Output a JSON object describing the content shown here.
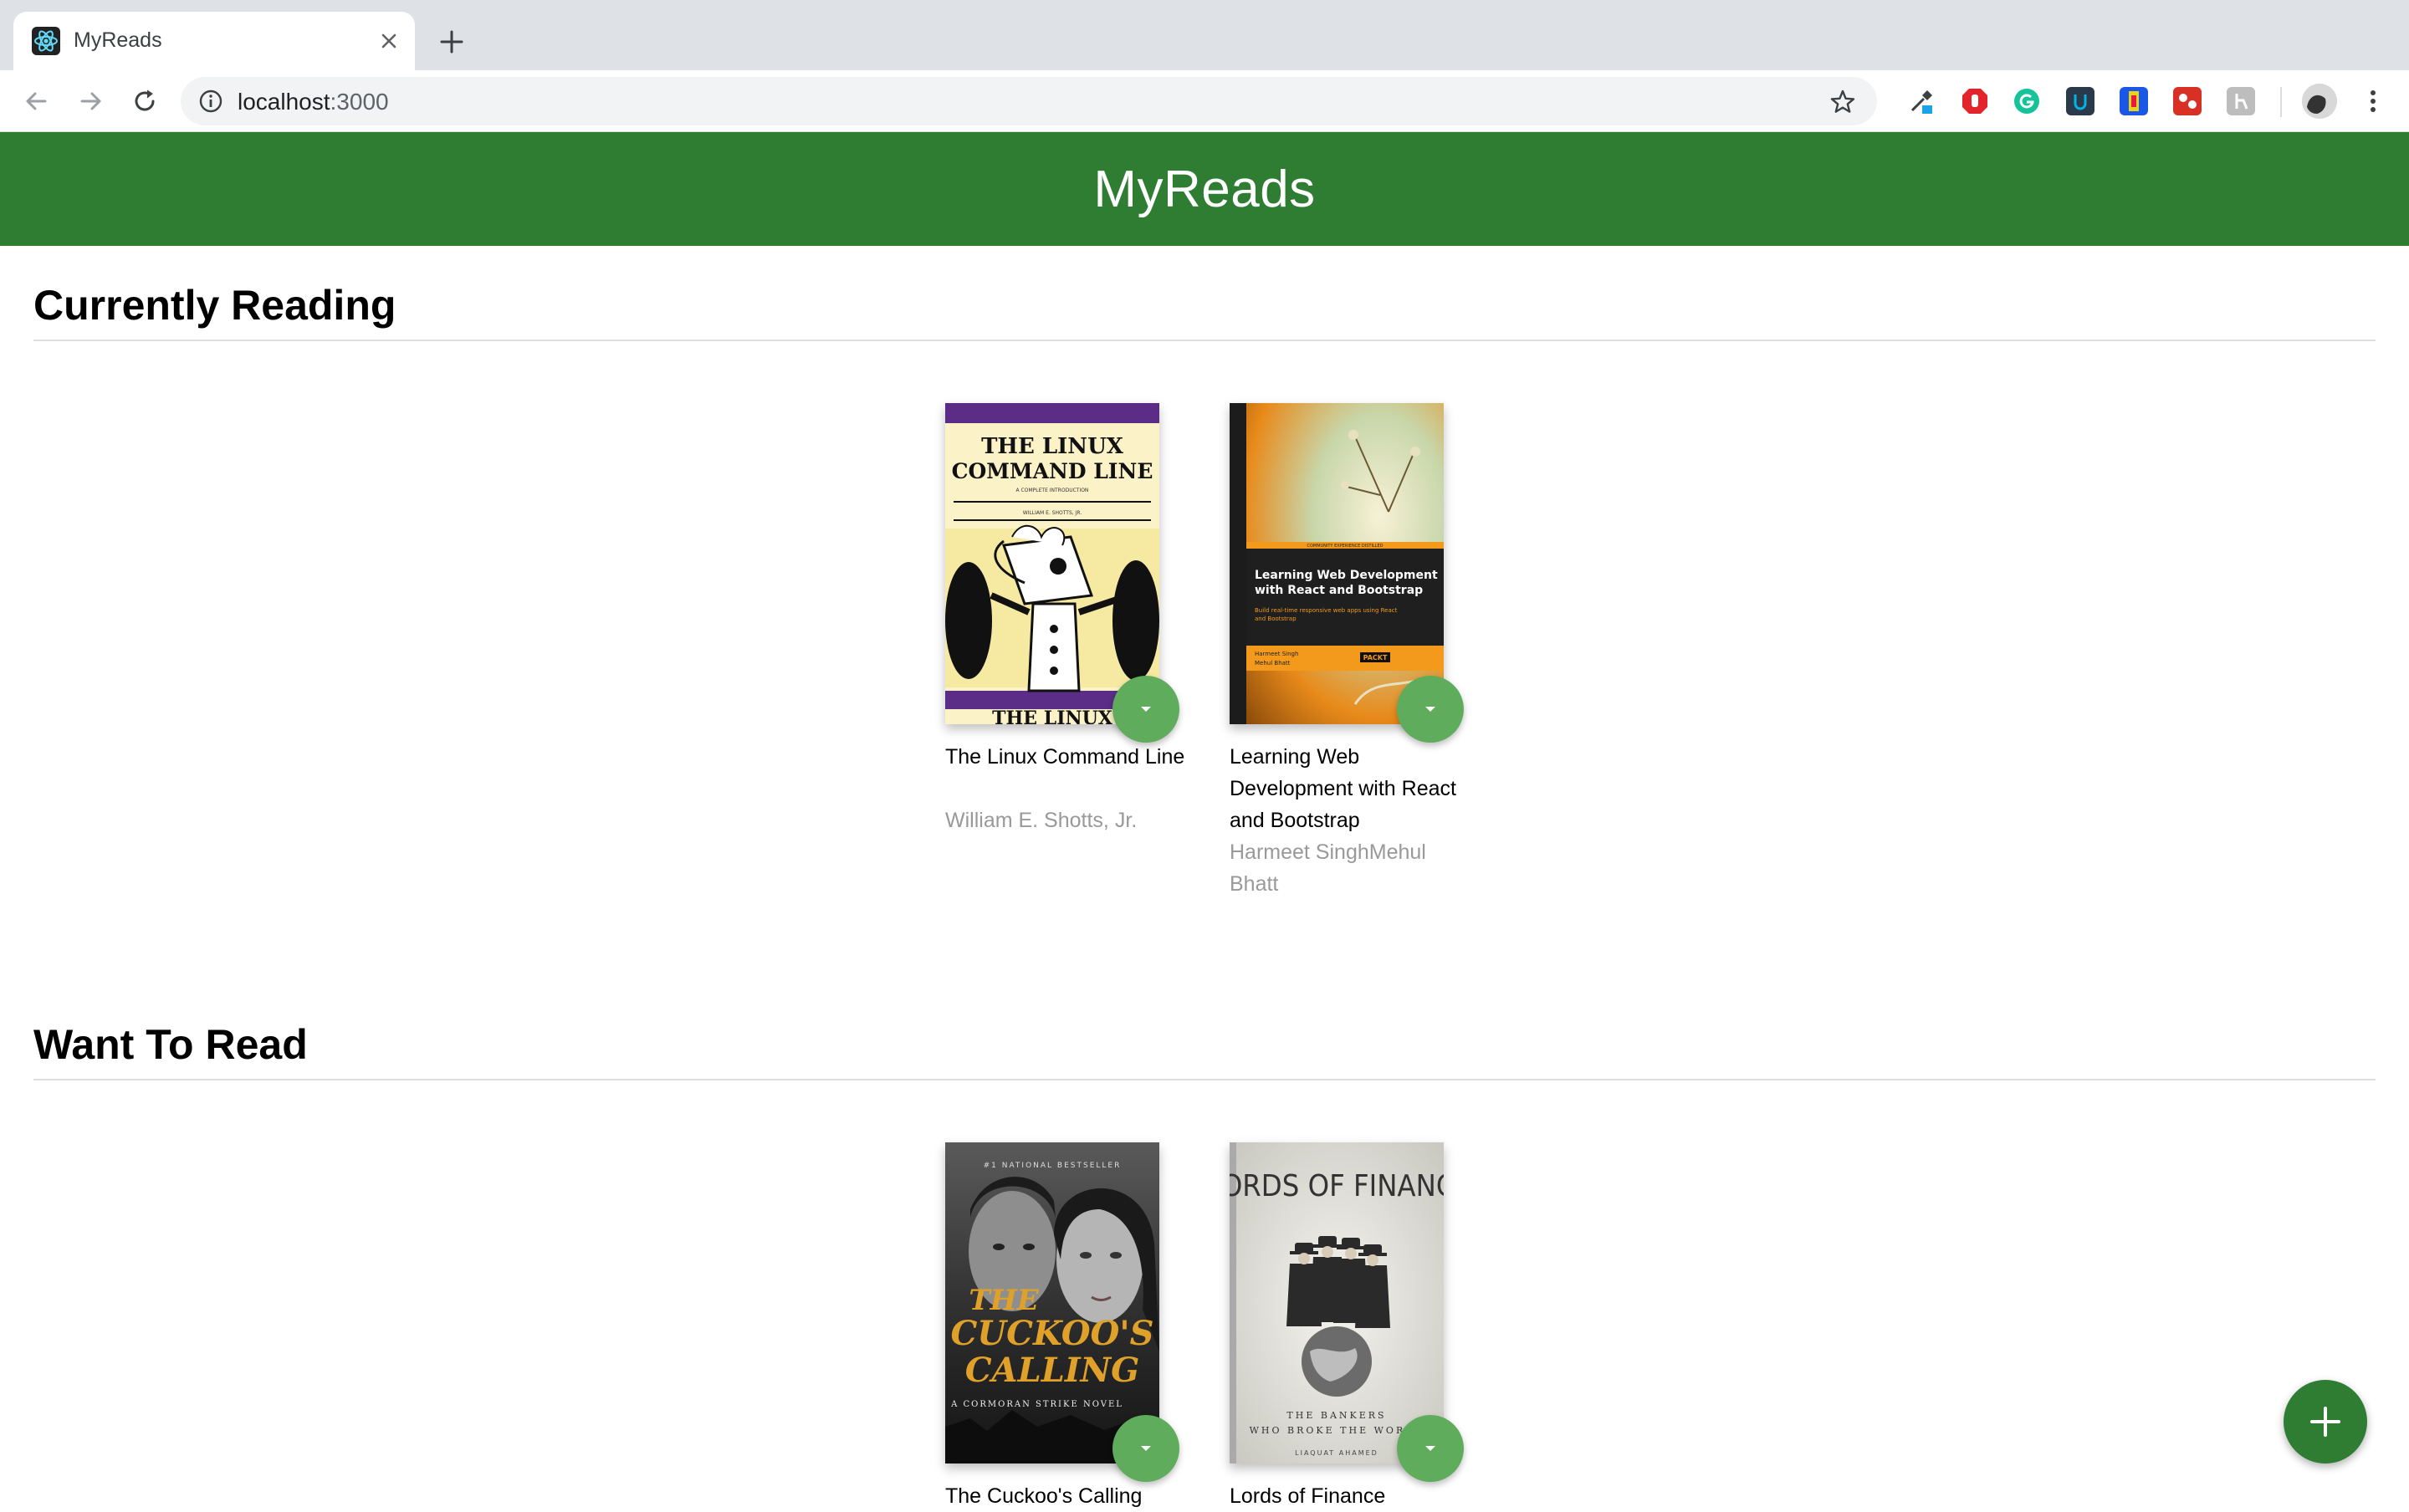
{
  "browser": {
    "tab_title": "MyReads",
    "url_host": "localhost",
    "url_port": ":3000"
  },
  "extensions": [
    "eyedropper-icon",
    "adblock-icon",
    "grammarly-icon",
    "extension-u-icon",
    "extension-colorful-icon",
    "extension-red-icon",
    "extension-gray-icon"
  ],
  "app": {
    "title": "MyReads",
    "accent_color": "#2e7d32",
    "button_color": "#60ac5d"
  },
  "shelves": [
    {
      "title": "Currently Reading",
      "books": [
        {
          "title": "The Linux Command Line",
          "authors": "William E. Shotts, Jr."
        },
        {
          "title": "Learning Web Development with React and Bootstrap",
          "authors": "Harmeet SinghMehul Bhatt"
        }
      ]
    },
    {
      "title": "Want To Read",
      "books": [
        {
          "title": "The Cuckoo's Calling",
          "authors": ""
        },
        {
          "title": "Lords of Finance",
          "authors": ""
        }
      ]
    }
  ],
  "covers": {
    "linux": {
      "line1": "THE LINUX",
      "line2": "COMMAND LINE",
      "sub": "A COMPLETE INTRODUCTION",
      "author": "WILLIAM E. SHOTTS, JR."
    },
    "react": {
      "series": "COMMUNITY EXPERIENCE DISTILLED",
      "title1": "Learning Web Development",
      "title2": "with React and Bootstrap",
      "tag1": "Build real-time responsive web apps using React",
      "tag2": "and Bootstrap",
      "author1": "Harmeet Singh",
      "author2": "Mehul Bhatt",
      "publisher": "PACKT"
    },
    "cuckoo": {
      "top": "#1 NATIONAL BESTSELLER",
      "line1": "THE",
      "line2": "CUCKOO'S",
      "line3": "CALLING",
      "sub": "A CORMORAN STRIKE NOVEL"
    },
    "lords": {
      "title": "LORDS OF FINANCE",
      "sub1": "THE BANKERS",
      "sub2": "WHO BROKE THE WORLD",
      "author": "LIAQUAT AHAMED"
    }
  }
}
